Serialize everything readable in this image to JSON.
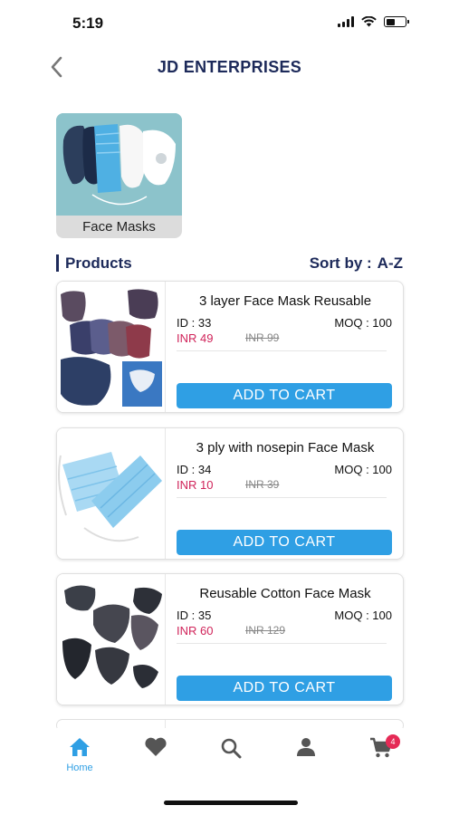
{
  "status_bar": {
    "time": "5:19",
    "battery_level": 0.45
  },
  "header": {
    "title": "JD ENTERPRISES",
    "back_icon": "chevron-left-icon"
  },
  "category": {
    "label": "Face Masks"
  },
  "products_section": {
    "title": "Products",
    "sort_label": "Sort by :",
    "sort_value": "A-Z"
  },
  "products": [
    {
      "name": "3 layer Face Mask Reusable",
      "id": "ID : 33",
      "moq": "MOQ : 100",
      "price": "INR 49",
      "mrp": "INR 99",
      "button": "ADD TO CART"
    },
    {
      "name": "3 ply with nosepin Face Mask",
      "id": "ID : 34",
      "moq": "MOQ : 100",
      "price": "INR 10",
      "mrp": "INR 39",
      "button": "ADD TO CART"
    },
    {
      "name": "Reusable Cotton Face Mask",
      "id": "ID : 35",
      "moq": "MOQ : 100",
      "price": "INR 60",
      "mrp": "INR 129",
      "button": "ADD TO CART"
    }
  ],
  "tab_bar": {
    "home_label": "Home",
    "cart_count": "4",
    "active_color": "#2f9fe4",
    "inactive_color": "#555555",
    "icons": [
      "home-icon",
      "heart-icon",
      "search-icon",
      "profile-icon",
      "cart-icon"
    ]
  },
  "colors": {
    "brand": "#1d2a5a",
    "accent": "#2f9fe4",
    "price": "#d0245a",
    "badge": "#e52a56"
  }
}
